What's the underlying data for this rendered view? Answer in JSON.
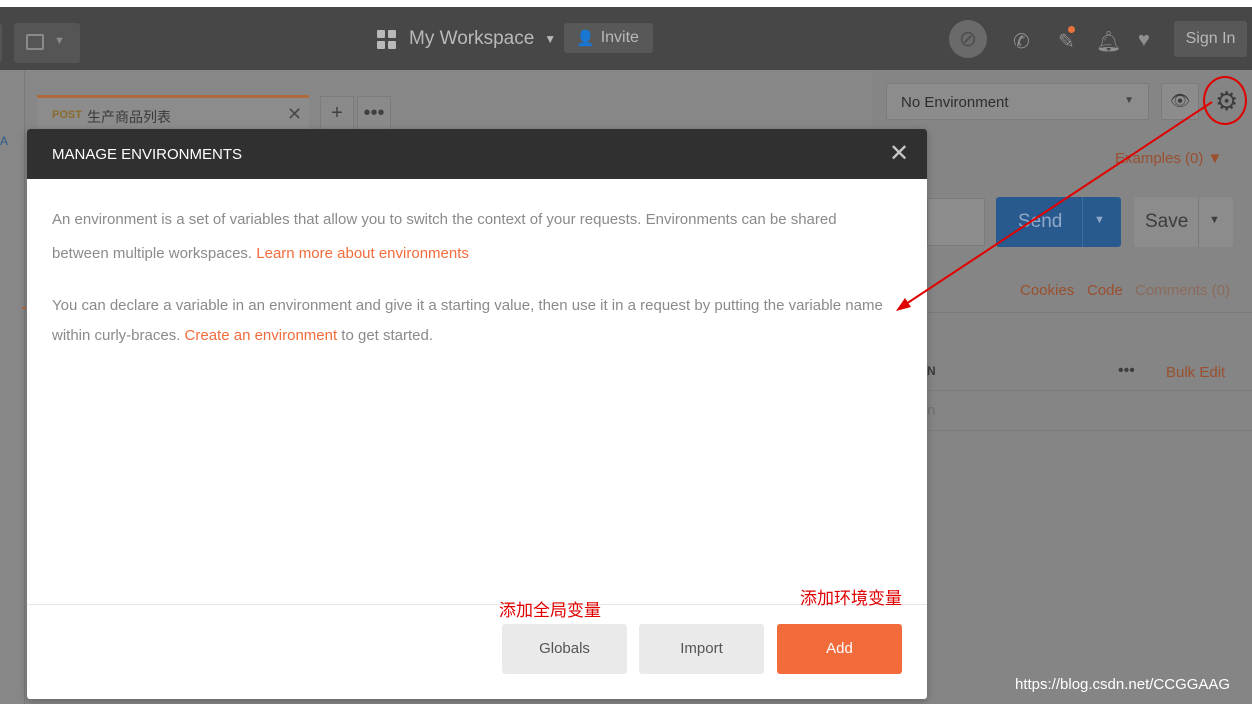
{
  "topbar": {
    "workspace": "My Workspace",
    "invite": "Invite",
    "sign_in": "Sign In"
  },
  "background": {
    "tab": {
      "method": "POST",
      "name": "生产商品列表"
    },
    "sidebar_letter": "A",
    "environment_select": "No Environment",
    "examples": "Examples (0)",
    "send": "Send",
    "save": "Save",
    "links": {
      "cookies": "Cookies",
      "code": "Code",
      "comments": "Comments (0)"
    },
    "table_header_partial": "N",
    "bulk_edit": "Bulk Edit",
    "placeholder_partial": "n"
  },
  "modal": {
    "title": "MANAGE ENVIRONMENTS",
    "p1_text": "An environment is a set of variables that allow you to switch the context of your requests. Environments can be shared between multiple workspaces. ",
    "p1_link": "Learn more about environments",
    "p2_text_before": "You can declare a variable in an environment and give it a starting value, then use it in a request by putting the variable name within curly-braces. ",
    "p2_link": "Create an environment",
    "p2_text_after": " to get started.",
    "buttons": {
      "globals": "Globals",
      "import": "Import",
      "add": "Add"
    }
  },
  "annotations": {
    "globals_note": "添加全局变量",
    "add_note": "添加环境变量"
  },
  "watermark": "https://blog.csdn.net/CCGGAAG",
  "colors": {
    "accent": "#f26b3a",
    "topbar": "#474747",
    "modal_header": "#303030",
    "annotation": "#e00000",
    "send_button": "#295a8f"
  }
}
